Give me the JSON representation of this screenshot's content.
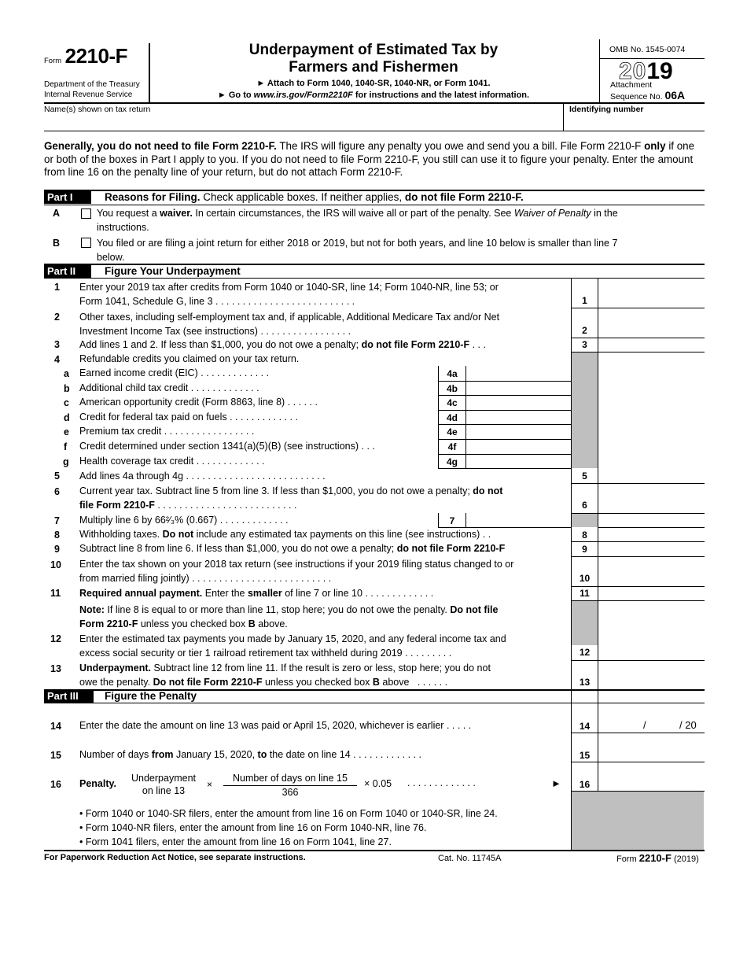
{
  "header": {
    "form_word": "Form",
    "form_number": "2210-F",
    "dept1": "Department of the Treasury",
    "dept2": "Internal Revenue Service",
    "title1": "Underpayment of Estimated Tax by",
    "title2": "Farmers and Fishermen",
    "attach": "► Attach to Form 1040, 1040-SR, 1040-NR, or Form 1041.",
    "goto_prefix": "► Go to ",
    "goto_url": "www.irs.gov/Form2210F",
    "goto_suffix": " for instructions and the latest information.",
    "omb": "OMB No. 1545-0074",
    "year_outline": "20",
    "year_solid": "19",
    "attachment": "Attachment",
    "sequence_label": "Sequence No.",
    "sequence_no": "06A",
    "name_label": "Name(s) shown on tax return",
    "id_label": "Identifying number",
    "name_value": "",
    "id_value": ""
  },
  "intro": {
    "bold": "Generally, you do not need to file Form 2210-F.",
    "t1": " The IRS will figure any penalty you owe and send you a bill. File Form 2210-F ",
    "only": "only",
    "t2": " if one or both of the boxes in Part I apply to you. If you do not need to file Form 2210-F, you still can use it to figure your penalty. Enter the amount from line 16 on the penalty line of your return, but do not attach Form 2210-F."
  },
  "part1": {
    "label": "Part I",
    "title_bold": "Reasons for Filing.",
    "title_text": " Check applicable boxes. If neither applies, ",
    "title_bold2": "do not file Form 2210-F.",
    "A": {
      "letter": "A",
      "t1": "You request a ",
      "b1": "waiver.",
      "t2": " In certain circumstances, the IRS will waive all or part of the penalty. See ",
      "i1": "Waiver of Penalty",
      "t3": " in the",
      "line2": "instructions.",
      "checked": false
    },
    "B": {
      "letter": "B",
      "t1": "You filed or are filing a joint return for either 2018 or 2019, but not for both years, and line 10 below is smaller than line 7",
      "line2": "below.",
      "checked": false
    }
  },
  "part2": {
    "label": "Part II",
    "title": "Figure Your Underpayment",
    "lines": {
      "l1a": "Enter your 2019 tax after credits from Form 1040 or 1040-SR, line 14; Form 1040-NR, line 53; or",
      "l1b": "Form 1041, Schedule G, line 3",
      "l2a": "Other taxes, including self-employment tax and, if applicable, Additional Medicare Tax and/or Net",
      "l2b": "Investment Income Tax (see instructions)",
      "l3": "Add lines 1 and 2. If less than $1,000, you do not owe a penalty; ",
      "l3b": "do not file Form 2210-F",
      "l4": "Refundable credits you claimed on your tax return.",
      "l4a": "Earned income credit (EIC)",
      "l4b": "Additional child tax credit",
      "l4c": "American opportunity credit (Form 8863, line 8)",
      "l4d": "Credit for federal tax paid on fuels",
      "l4e": "Premium tax credit",
      "l4f": "Credit determined under section 1341(a)(5)(B) (see instructions)",
      "l4g": "Health coverage tax credit",
      "l5": "Add lines 4a through 4g",
      "l6a": "Current year tax. Subtract line 5 from line 3. If less than $1,000, you do not owe a penalty; ",
      "l6ab": "do not",
      "l6b": "file Form 2210-F",
      "l7": "Multiply line 6 by 66²⁄₃% (0.667)",
      "l8a": "Withholding taxes. ",
      "l8b": "Do not",
      "l8c": " include any estimated tax payments on this line (see instructions)",
      "l9a": "Subtract line 8 from line 6. If less than $1,000, you do not owe a penalty; ",
      "l9b": "do not file Form 2210-F",
      "l10a": "Enter the tax shown on your 2018 tax return (see instructions if your 2019 filing status changed to or",
      "l10b": "from married filing jointly)",
      "l11a": "Required annual payment.",
      "l11b": " Enter the ",
      "l11c": "smaller",
      "l11d": " of line 7 or line 10",
      "note_a": "Note:",
      "note_b": " If line 8 is equal to or more than line 11, stop here; you do not owe the penalty. ",
      "note_c": "Do not file",
      "note_d": "Form 2210-F",
      "note_e": " unless you checked box ",
      "note_f": "B",
      "note_g": " above.",
      "l12a": "Enter the estimated tax payments you made by January 15, 2020, and any federal income tax and",
      "l12b": "excess social security or tier 1 railroad retirement tax withheld during 2019",
      "l13a": "Underpayment.",
      "l13b": " Subtract line 12 from line 11. If the result is zero or less, stop here; you do not",
      "l13c": "owe the penalty. ",
      "l13d": "Do not file Form 2210-F",
      "l13e": " unless you checked box ",
      "l13f": "B",
      "l13g": " above"
    },
    "nums": {
      "n1": "1",
      "n2": "2",
      "n3": "3",
      "n4": "4",
      "a": "a",
      "b": "b",
      "c": "c",
      "d": "d",
      "e": "e",
      "f": "f",
      "g": "g",
      "n5": "5",
      "n6": "6",
      "n7": "7",
      "n8": "8",
      "n9": "9",
      "n10": "10",
      "n11": "11",
      "n12": "12",
      "n13": "13"
    },
    "boxes": {
      "b4a": "4a",
      "b4b": "4b",
      "b4c": "4c",
      "b4d": "4d",
      "b4e": "4e",
      "b4f": "4f",
      "b4g": "4g"
    }
  },
  "part3": {
    "label": "Part III",
    "title": "Figure the Penalty",
    "l14": "Enter the date the amount on line 13 was paid or April 15, 2020, whichever is earlier",
    "l14_slash": "/",
    "l14_year": "/ 20",
    "l15a": "Number of days ",
    "l15b": "from",
    "l15c": " January 15, 2020, ",
    "l15d": "to",
    "l15e": " the date on line 14",
    "l16_label": "Penalty.",
    "l16_num1": "Underpayment",
    "l16_num2": "on line 13",
    "l16_times": "×",
    "l16_frac_num": "Number of days on line 15",
    "l16_frac_den": "366",
    "l16_rate": "× 0.05",
    "l16_arrow": "►",
    "n14": "14",
    "n15": "15",
    "n16": "16",
    "bullets": [
      "• Form 1040 or 1040-SR filers, enter the amount from line 16 on Form 1040 or 1040-SR, line 24.",
      "• Form 1040-NR filers, enter the amount from line 16 on Form 1040-NR, line 76.",
      "• Form 1041 filers, enter the amount from line 16 on Form 1041, line 27."
    ]
  },
  "footer": {
    "notice": "For Paperwork Reduction Act Notice, see separate instructions.",
    "cat": "Cat. No. 11745A",
    "form_word": "Form",
    "form_num": "2210-F",
    "year": "(2019)"
  },
  "dots": {
    "long": ". . . . . . . . . . . . . . . . . . . . . . . . . .",
    "mid": ". . . . . . . . . . . . . . . . .",
    "short": ". . . . . . . . . . . . .",
    "tiny": ". . .",
    "two": ". ."
  }
}
